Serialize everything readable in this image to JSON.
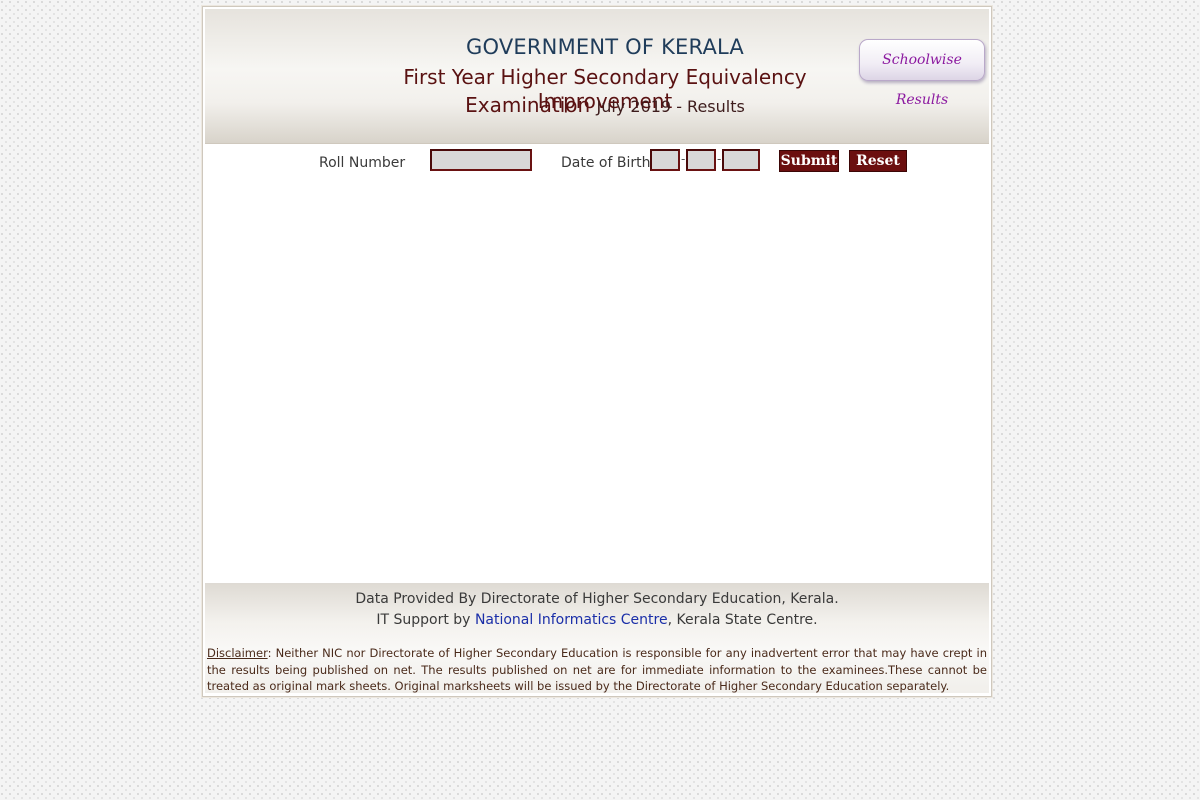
{
  "header": {
    "line1": "GOVERNMENT OF KERALA",
    "line2": "First Year Higher Secondary Equivalency Improvement",
    "line3_main": "Examination",
    "line3_small": "July 2019 - Results",
    "schoolwise_button": "Schoolwise Results"
  },
  "form": {
    "roll_label": "Roll Number",
    "roll_value": "",
    "dob_label": "Date of Birth",
    "dob_day": "",
    "dob_month": "",
    "dob_year": "",
    "separator": "-",
    "submit_label": "Submit",
    "reset_label": "Reset"
  },
  "footer": {
    "line1": "Data Provided By Directorate of Higher Secondary Education, Kerala.",
    "line2_prefix": "IT Support by",
    "line2_link": "National Informatics Centre",
    "line2_suffix": ", Kerala State Centre.",
    "disclaimer_label": "Disclaimer",
    "disclaimer_text": ": Neither NIC nor Directorate of Higher Secondary Education is responsible for any inadvertent error that may have crept in the results being published on net. The results published on net are for immediate information to the examinees.These cannot be treated as original mark sheets. Original marksheets will be issued by the Directorate of Higher Secondary Education separately."
  },
  "colors": {
    "accent_maroon": "#6b0f0f",
    "title_blue": "#1f3c5a",
    "link_blue": "#1a2ea8",
    "schoolwise_purple": "#8c1aa0"
  }
}
